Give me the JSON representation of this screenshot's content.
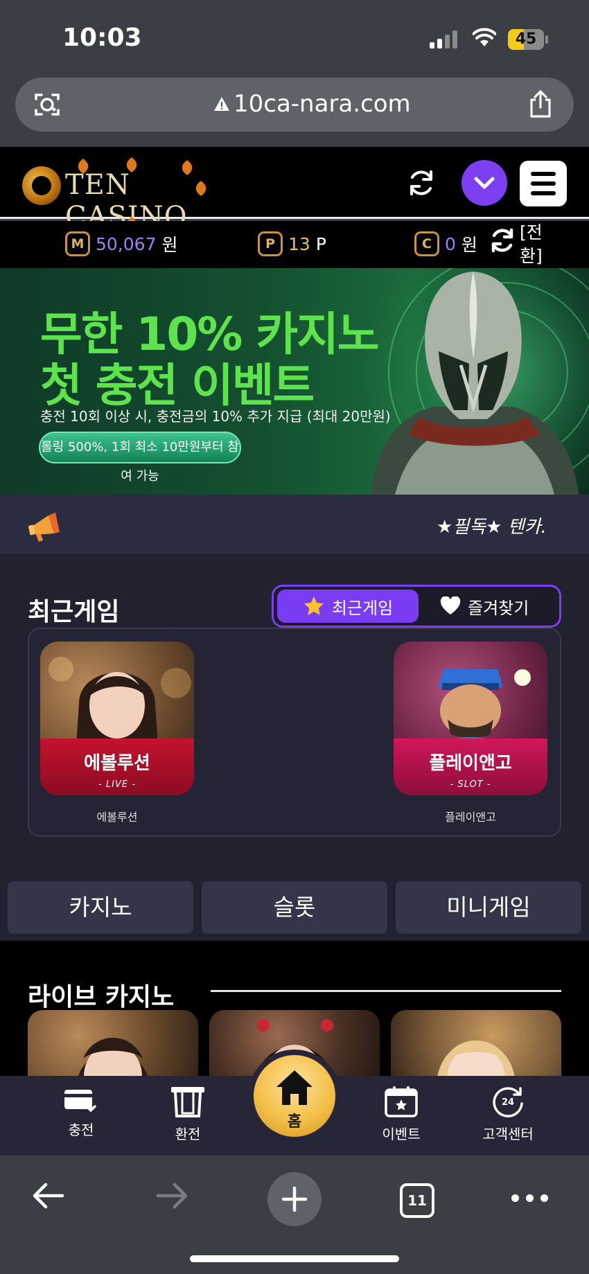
{
  "status_bar": {
    "time": "10:03",
    "battery": "45",
    "battery_level": 0.45
  },
  "browser": {
    "url": "10ca-nara.com",
    "tab_count": "11"
  },
  "header": {
    "logo_text": "TEN CASINO"
  },
  "balance": {
    "money_icon": "M",
    "money_value": "50,067",
    "money_unit": "원",
    "point_icon": "P",
    "point_value": "13",
    "point_unit": "P",
    "comp_icon": "C",
    "comp_value": "0",
    "comp_unit": "원",
    "convert_label": "[전환]"
  },
  "banner": {
    "line1": "무한 10% 카지노",
    "line2": "첫 충전 이벤트",
    "subtitle": "충전 10회 이상 시, 충전금의 10% 추가 지급 (최대 20만원)",
    "pill": "롤링 500%, 1회 최소 10만원부터 참여 가능"
  },
  "notice": {
    "text": "★필독★ 텐카."
  },
  "recent_games": {
    "title": "최근게임",
    "tab_recent": "최근게임",
    "tab_favorites": "즐겨찾기",
    "games": [
      {
        "card_title": "에볼루션",
        "card_sub": "- LIVE -",
        "label": "에볼루션"
      },
      {
        "card_title": "플레이앤고",
        "card_sub": "- SLOT -",
        "label": "플레이앤고"
      }
    ]
  },
  "categories": [
    "카지노",
    "슬롯",
    "미니게임"
  ],
  "live_casino": {
    "title": "라이브 카지노"
  },
  "bottom_nav": {
    "charge": "충전",
    "exchange": "환전",
    "home": "홈",
    "event": "이벤트",
    "support": "고객센터"
  },
  "colors": {
    "accent": "#7a3cf0",
    "gold": "#f3c04a",
    "banner_green": "#5ee34f",
    "card_red": "#c3132f"
  },
  "icons": [
    "camera-lens-icon",
    "warning-icon",
    "share-icon",
    "refresh-icon",
    "chevron-down-icon",
    "hamburger-menu-icon",
    "megaphone-icon",
    "star-icon",
    "heart-icon",
    "card-icon",
    "atm-icon",
    "home-icon",
    "calendar-star-icon",
    "24h-support-icon",
    "back-arrow-icon",
    "forward-arrow-icon",
    "plus-icon",
    "more-icon"
  ]
}
